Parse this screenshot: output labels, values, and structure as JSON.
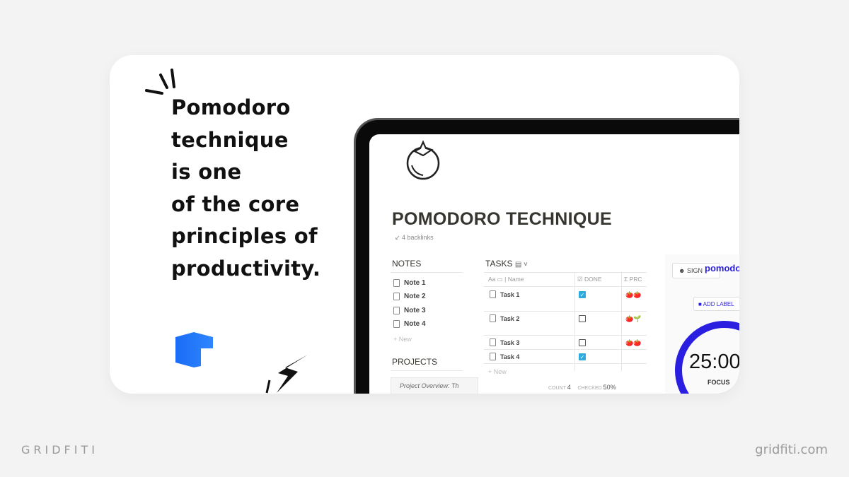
{
  "headline": [
    "Pomodoro",
    "technique",
    "is one",
    "of the core",
    "principles of",
    "productivity."
  ],
  "notion": {
    "title": "POMODORO TECHNIQUE",
    "backlinks": "↙ 4 backlinks",
    "notes": {
      "heading": "NOTES",
      "items": [
        "Note 1",
        "Note 2",
        "Note 3",
        "Note 4"
      ],
      "new": "+ New"
    },
    "projects": {
      "heading": "PROJECTS",
      "item": "Project Overview: Th"
    },
    "tasks": {
      "heading": "TASKS",
      "columns": [
        "Aa ▭ | Name",
        "☑ DONE",
        "Σ PRC"
      ],
      "rows": [
        {
          "name": "Task 1",
          "done": true,
          "progress": "🍅🍅"
        },
        {
          "name": "Task 2",
          "done": false,
          "progress": "🍅🌱"
        },
        {
          "name": "Task 3",
          "done": false,
          "progress": "🍅🍅"
        },
        {
          "name": "Task 4",
          "done": true,
          "progress": ""
        }
      ],
      "new": "+ New",
      "count_label": "COUNT",
      "count": "4",
      "checked_label": "CHECKED",
      "checked": "50%"
    }
  },
  "pomodoro": {
    "sign": "SIGN",
    "logo": "pomodo",
    "add_label": "ADD LABEL",
    "time": "25:00",
    "mode": "FOCUS",
    "accent": "#2a1fe0"
  },
  "footer": {
    "brand": "GRIDFITI",
    "url": "gridfiti.com"
  }
}
